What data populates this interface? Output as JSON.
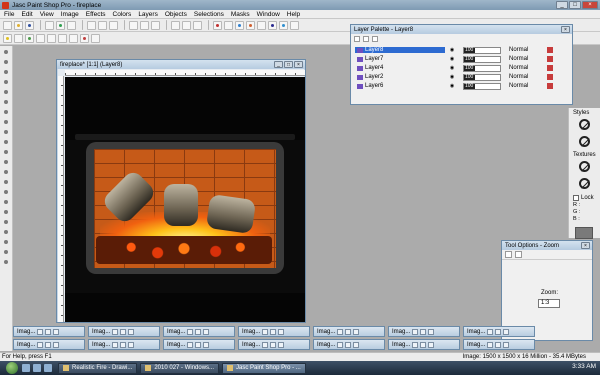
{
  "app": {
    "title": "Jasc Paint Shop Pro - fireplace"
  },
  "menu": [
    "File",
    "Edit",
    "View",
    "Image",
    "Effects",
    "Colors",
    "Layers",
    "Objects",
    "Selections",
    "Masks",
    "Window",
    "Help"
  ],
  "image_window": {
    "title": "fireplace* [1:1] (Layer8)"
  },
  "layer_palette": {
    "title": "Layer Palette - Layer8",
    "layers": [
      {
        "name": "Layer8",
        "opacity": "100",
        "blend": "Normal"
      },
      {
        "name": "Layer7",
        "opacity": "100",
        "blend": "Normal"
      },
      {
        "name": "Layer4",
        "opacity": "100",
        "blend": "Normal"
      },
      {
        "name": "Layer2",
        "opacity": "100",
        "blend": "Normal"
      },
      {
        "name": "Layer6",
        "opacity": "100",
        "blend": "Normal"
      }
    ]
  },
  "materials": {
    "styles": "Styles",
    "textures": "Textures",
    "lock": "Lock",
    "r": "R :",
    "g": "G :",
    "b": "B :"
  },
  "tool_options": {
    "title": "Tool Options - Zoom",
    "zoom_label": "Zoom:",
    "zoom_value": "1:3"
  },
  "minimized": {
    "label": "Imag..."
  },
  "status": {
    "left": "For Help, press F1",
    "right": "Image: 1500 x 1500 x 16 Million - 35.4 MBytes"
  },
  "taskbar": {
    "buttons": [
      "Realistic Fire - Drawi...",
      "2010 027 - Windows...",
      "Jasc Paint Shop Pro - ..."
    ],
    "time": "3:33 AM"
  }
}
